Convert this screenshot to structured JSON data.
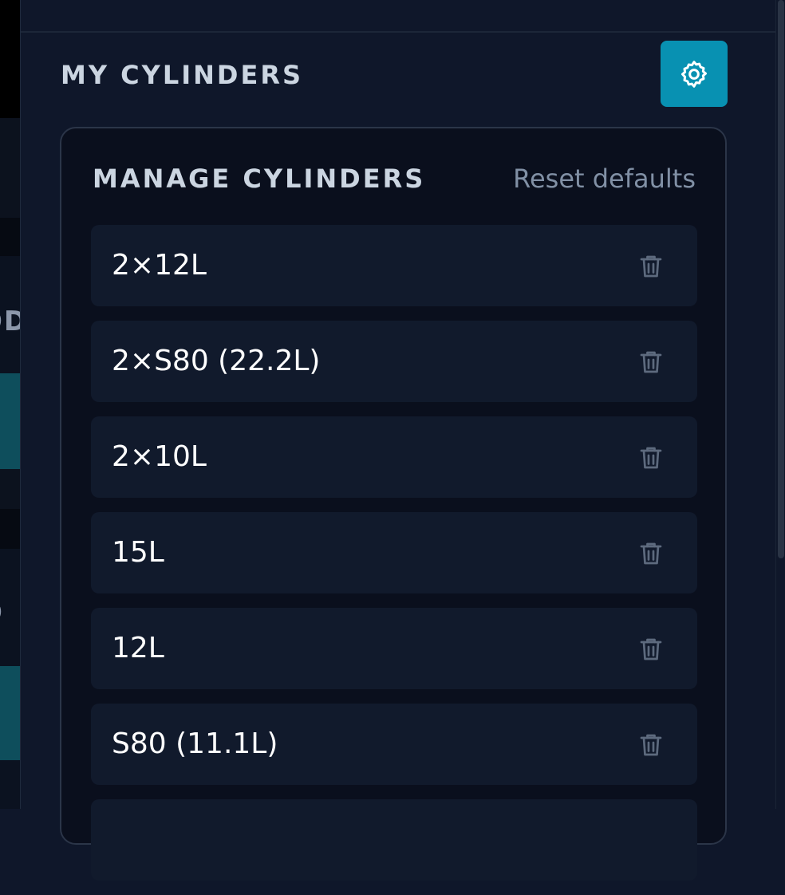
{
  "left_edge": {
    "fragment_1": "OD",
    "fragment_2": "O"
  },
  "panel": {
    "title": "MY CYLINDERS",
    "settings_icon": "gear-icon",
    "accent_color": "#0891b2"
  },
  "manager": {
    "title": "MANAGE CYLINDERS",
    "reset_label": "Reset defaults",
    "items": [
      {
        "label": "2×12L",
        "icon": "trash-icon"
      },
      {
        "label": "2×S80 (22.2L)",
        "icon": "trash-icon"
      },
      {
        "label": "2×10L",
        "icon": "trash-icon"
      },
      {
        "label": "15L",
        "icon": "trash-icon"
      },
      {
        "label": "12L",
        "icon": "trash-icon"
      },
      {
        "label": "S80 (11.1L)",
        "icon": "trash-icon"
      },
      {
        "label": "",
        "icon": "trash-icon"
      }
    ]
  }
}
